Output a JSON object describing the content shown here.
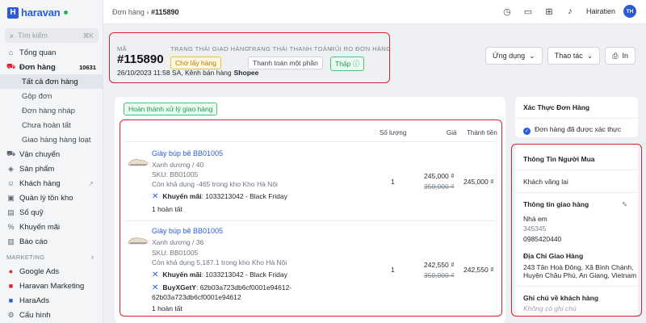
{
  "brand": {
    "name": "haravan"
  },
  "search": {
    "placeholder": "Tìm kiếm",
    "shortcut": "⌘K"
  },
  "nav": {
    "items": [
      {
        "label": "Tổng quan",
        "icon": "home-icon"
      },
      {
        "label": "Đơn hàng",
        "icon": "cart-icon",
        "badge": "10631"
      },
      {
        "label": "Tất cả đơn hàng",
        "sub": true,
        "active": true
      },
      {
        "label": "Gộp đơn",
        "sub": true
      },
      {
        "label": "Đơn hàng nháp",
        "sub": true
      },
      {
        "label": "Chưa hoàn tất",
        "sub": true
      },
      {
        "label": "Giao hàng hàng loạt",
        "sub": true
      },
      {
        "label": "Vận chuyển",
        "icon": "truck-icon"
      },
      {
        "label": "Sản phẩm",
        "icon": "tag-icon"
      },
      {
        "label": "Khách hàng",
        "icon": "users-icon"
      },
      {
        "label": "Quản lý tồn kho",
        "icon": "box-icon"
      },
      {
        "label": "Sổ quỹ",
        "icon": "wallet-icon"
      },
      {
        "label": "Khuyến mãi",
        "icon": "percent-icon"
      },
      {
        "label": "Báo cáo",
        "icon": "chart-icon"
      }
    ],
    "marketing_label": "MARKETING",
    "marketing_items": [
      {
        "label": "Google Ads",
        "icon": "google-icon"
      },
      {
        "label": "Haravan Marketing",
        "icon": "megaphone-icon"
      },
      {
        "label": "HaraAds",
        "icon": "ads-icon"
      },
      {
        "label": "Cấu hình",
        "icon": "gear-icon"
      }
    ]
  },
  "topbar": {
    "crumb_parent": "Đơn hàng",
    "crumb_sep": "›",
    "crumb_current": "#115890",
    "user_name": "Hairatien",
    "user_initials": "TH"
  },
  "order": {
    "code_label": "MÃ",
    "code": "#115890",
    "date": "26/10/2023 11:58 SA, Kênh bán hàng",
    "channel": "Shopee",
    "delivery_label": "TRẠNG THÁI GIAO HÀNG",
    "delivery_status": "Chờ lấy hàng",
    "payment_label": "TRẠNG THÁI THANH TOÁN",
    "payment_status": "Thanh toán một phần",
    "risk_label": "RỦI RO ĐƠN HÀNG",
    "risk_status": "Thấp",
    "btn_apps": "Ứng dụng",
    "btn_actions": "Thao tác",
    "btn_print": "In"
  },
  "items_card": {
    "status": "Hoàn thành xử lý giao hàng",
    "col_qty": "Số lượng",
    "col_price": "Giá",
    "col_total": "Thành tiền",
    "items": [
      {
        "name": "Giày búp bê BB01005",
        "variant": "Xanh dương / 40",
        "sku": "SKU: BB01005",
        "stock": "Còn khả dụng -465 trong kho Kho Hà Nội",
        "promo_label": "Khuyến mãi",
        "promo_value": ": 1033213042 - Black Friday",
        "done": "1 hoàn tất",
        "qty": "1",
        "price": "245,000 ₫",
        "orig_price": "350,000 ₫",
        "total": "245,000 ₫"
      },
      {
        "name": "Giày búp bê BB01005",
        "variant": "Xanh dương / 36",
        "sku": "SKU: BB01005",
        "stock": "Còn khả dụng 5,187.1 trong kho Kho Hà Nội",
        "promo_label": "Khuyến mãi",
        "promo_value": ": 1033213042 - Black Friday",
        "promo2_label": "BuyXGetY",
        "promo2_value": ": 62b03a723db6cf0001e94612-",
        "promo2_value2": "62b03a723db6cf0001e94612",
        "done": "1 hoàn tất",
        "qty": "1",
        "price": "242,550 ₫",
        "orig_price": "350,000 ₫",
        "total": "242,550 ₫"
      }
    ]
  },
  "verify": {
    "title": "Xác Thực Đơn Hàng",
    "text": "Đơn hàng đã được xác thực"
  },
  "buyer": {
    "title": "Thông Tin Người Mua",
    "name": "Khách vãng lai",
    "shipping_title": "Thông tin giao hàng",
    "ship_name": "Nhà em",
    "ship_code": "345345",
    "ship_phone": "0985420440",
    "address_title": "Địa Chỉ Giao Hàng",
    "address_line1": "243 Tân Hoà Đông, Xã Bình Chánh,",
    "address_line2": "Huyện Châu Phú, An Giang, Vietnam",
    "note_title": "Ghi chú về khách hàng",
    "note_text": "Không có ghi chú"
  }
}
